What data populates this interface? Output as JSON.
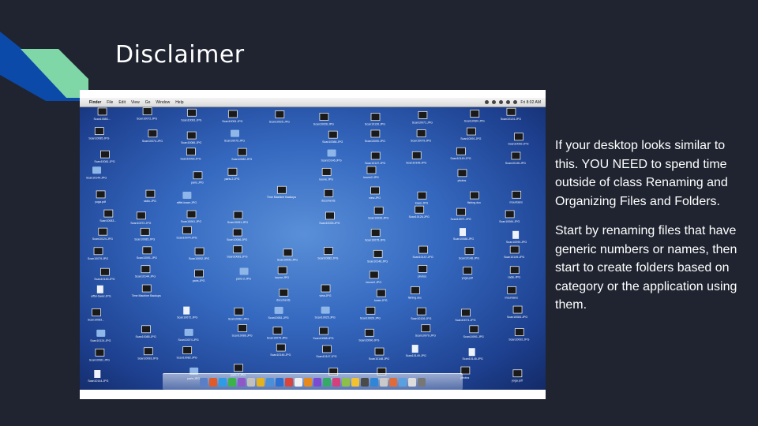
{
  "slide": {
    "title": "Disclaimer",
    "paragraph1": "If your desktop looks similar to this.  YOU NEED to spend time outside of class Renaming and Organizing Files and Folders.",
    "paragraph2": "Start by renaming files that have generic numbers or names, then start to create folders based on category or the application using them."
  },
  "colors": {
    "background": "#1f2430",
    "accent_blue": "#0b4aa8",
    "accent_mint": "#7fd6a7",
    "text": "#ffffff"
  },
  "screenshot": {
    "menubar": {
      "apple_glyph": "",
      "items": [
        "Finder",
        "File",
        "Edit",
        "View",
        "Go",
        "Window",
        "Help"
      ],
      "clock": "Fri 8:02 AM"
    },
    "file_labels": [
      "Scan10083...",
      "Scan10072.JPG",
      "Scan10061.JPG",
      "Scan10051.JPG",
      "Scan10025.JPG",
      "Scan10026.JPG",
      "Scan10126.JPG",
      "Scan10071.JPG",
      "Scan10084.JPG",
      "Scan10124.JPG",
      "Scan10085.JPG",
      "Scan10074.JPG",
      "Scan10086.JPG",
      "Scan10075.JPG",
      "Scan10088.JPG",
      "Scan10090.JPG",
      "Scan10079.JPG",
      "Scan10091.JPG",
      "Scan10092.JPG",
      "Scan10081.JPG",
      "Scan10093.JPG",
      "Scan10082.JPG",
      "Scan10146.JPG",
      "Scan10147.JPG",
      "Scan10148.JPG",
      "Scan10149.JPG",
      "Scan10145.JPG",
      "Scan10144.JPG",
      "paris.JPG",
      "paris-2.JPG",
      "louvre.JPG",
      "louvre2.JPG",
      "photos",
      "yoga.pdf",
      "radio.JPG",
      "eiffel-tower.JPG",
      "Time Machine Backups",
      "documents",
      "view.JPG",
      "tower.JPG",
      "fishing.doc",
      "mountains"
    ],
    "dock_icon_colors": [
      "#5b7fc7",
      "#e05a2a",
      "#2e9be6",
      "#3bb34a",
      "#8f58c9",
      "#c0c0c0",
      "#e3b21f",
      "#4a90d9",
      "#2b6fd1",
      "#d9443b",
      "#f0f0f0",
      "#e68a1e",
      "#7a4bd1",
      "#33aa66",
      "#d43f7c",
      "#8cc04a",
      "#f2c230",
      "#4a4a4a",
      "#2f86d6",
      "#c9c9c9",
      "#e06b3a",
      "#5aa0e0",
      "#dddddd",
      "#777777"
    ]
  }
}
